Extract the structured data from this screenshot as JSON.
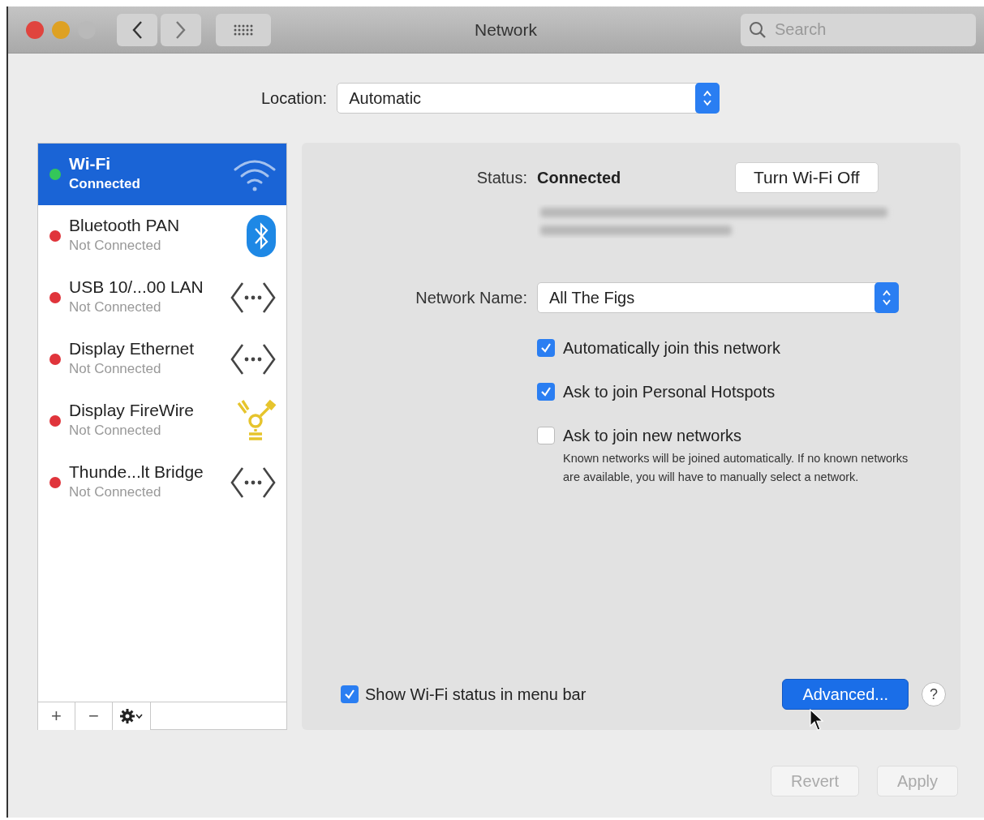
{
  "window": {
    "title": "Network",
    "search": {
      "placeholder": "Search"
    }
  },
  "location": {
    "label": "Location:",
    "value": "Automatic"
  },
  "sidebar": {
    "items": [
      {
        "name": "Wi-Fi",
        "status": "Connected",
        "color": "#34c759",
        "kind": "wifi",
        "selected": true
      },
      {
        "name": "Bluetooth PAN",
        "status": "Not Connected",
        "color": "#e0343b",
        "kind": "bluetooth",
        "selected": false
      },
      {
        "name": "USB 10/...00 LAN",
        "status": "Not Connected",
        "color": "#e0343b",
        "kind": "ethernet",
        "selected": false
      },
      {
        "name": "Display Ethernet",
        "status": "Not Connected",
        "color": "#e0343b",
        "kind": "ethernet",
        "selected": false
      },
      {
        "name": "Display FireWire",
        "status": "Not Connected",
        "color": "#e0343b",
        "kind": "firewire",
        "selected": false
      },
      {
        "name": "Thunde...lt Bridge",
        "status": "Not Connected",
        "color": "#e0343b",
        "kind": "ethernet",
        "selected": false
      }
    ],
    "add": "+",
    "remove": "−"
  },
  "detail": {
    "status_label": "Status:",
    "status_value": "Connected",
    "toggle_button": "Turn Wi-Fi Off",
    "network_label": "Network Name:",
    "network_value": "All The Figs",
    "options": [
      {
        "label": "Automatically join this network",
        "checked": true
      },
      {
        "label": "Ask to join Personal Hotspots",
        "checked": true
      },
      {
        "label": "Ask to join new networks",
        "checked": false
      }
    ],
    "note": "Known networks will be joined automatically. If no known networks are available, you will have to manually select a network.",
    "menu_bar": {
      "label": "Show Wi-Fi status in menu bar",
      "checked": true
    },
    "advanced": "Advanced...",
    "help": "?"
  },
  "footer": [
    {
      "label": "Revert",
      "disabled": true
    },
    {
      "label": "Apply",
      "disabled": true
    }
  ]
}
